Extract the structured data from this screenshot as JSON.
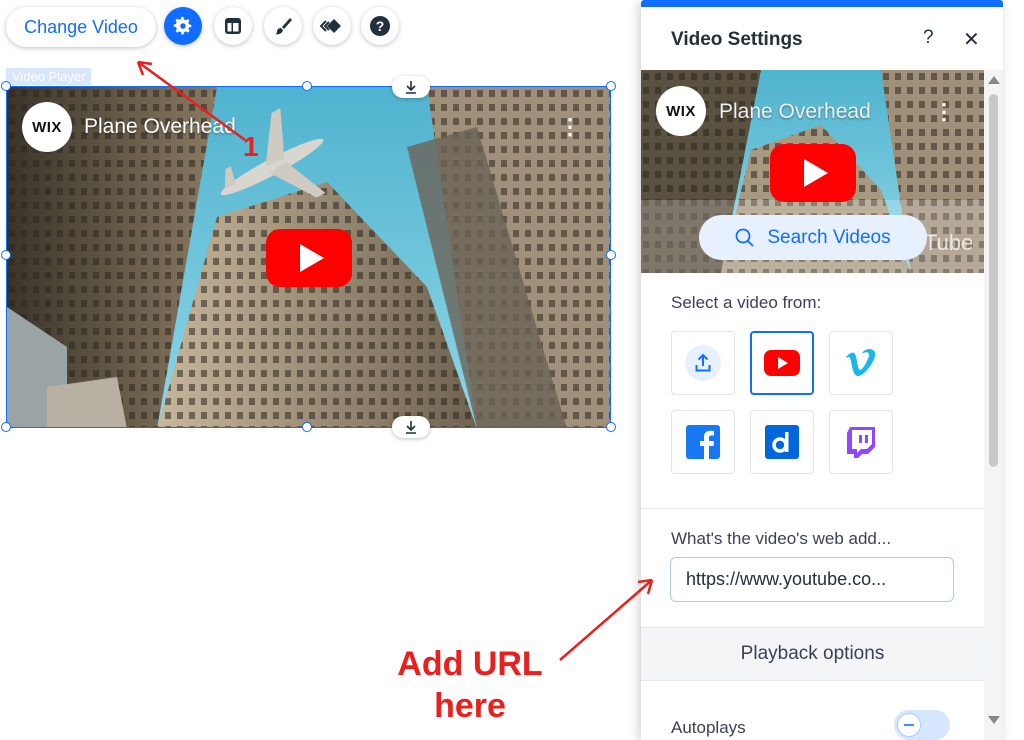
{
  "toolbar": {
    "change_video_label": "Change Video",
    "tools": [
      {
        "name": "settings-icon",
        "active": true
      },
      {
        "name": "layout-icon",
        "active": false
      },
      {
        "name": "design-brush-icon",
        "active": false
      },
      {
        "name": "animation-icon",
        "active": false
      },
      {
        "name": "help-icon",
        "active": false
      }
    ]
  },
  "element_label": "Video Player",
  "video": {
    "channel_logo": "WIX",
    "title": "Plane Overhead"
  },
  "panel": {
    "title": "Video Settings",
    "help_glyph": "?",
    "close_glyph": "✕",
    "preview": {
      "channel_logo": "WIX",
      "title": "Plane Overhead",
      "watermark": "Tube"
    },
    "search_label": "Search Videos",
    "select_label": "Select a video from:",
    "sources": [
      {
        "name": "upload",
        "selected": false
      },
      {
        "name": "youtube",
        "selected": true
      },
      {
        "name": "vimeo",
        "selected": false
      },
      {
        "name": "facebook",
        "selected": false
      },
      {
        "name": "dailymotion",
        "selected": false
      },
      {
        "name": "twitch",
        "selected": false
      }
    ],
    "url_label": "What's the video's web add...",
    "url_value": "https://www.youtube.co...",
    "playback_label": "Playback options",
    "autoplay_label": "Autoplays",
    "autoplay_on": false
  },
  "annotations": {
    "step_number": "1",
    "instruction_line1": "Add URL",
    "instruction_line2": "here"
  },
  "colors": {
    "accent": "#116dff",
    "annotation": "#e8201e",
    "youtube_red": "#ff0000",
    "vimeo": "#1ab7ea",
    "facebook": "#1877f2",
    "dailymotion": "#0066dc",
    "twitch": "#9146ff"
  }
}
